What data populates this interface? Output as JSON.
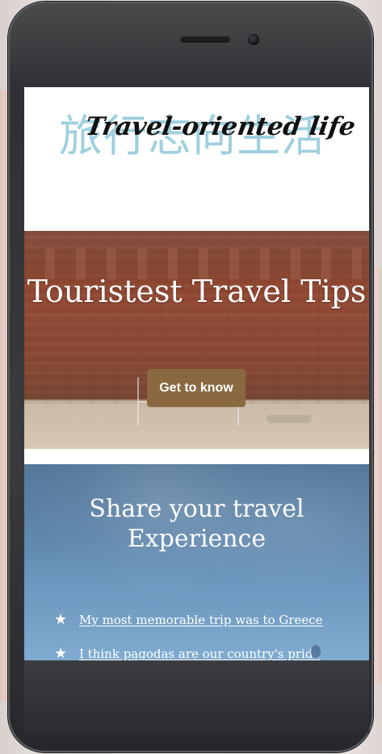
{
  "header": {
    "logo_cn": "旅行志向生活",
    "logo_en": "Travel-oriented life"
  },
  "hero": {
    "title": "Touristest Travel Tips",
    "button_label": "Get to know"
  },
  "share": {
    "title": "Share your travel Experience",
    "items": [
      {
        "icon": "star-icon",
        "label": "My most memorable trip was to Greece"
      },
      {
        "icon": "star-icon",
        "label": "I think pagodas are our country's pride"
      }
    ]
  },
  "colors": {
    "logo_cn": "#9fd0df",
    "logo_en": "#111111",
    "button": "#8a6840",
    "hero_text": "#ffffff",
    "sky_text": "#ffffff"
  }
}
